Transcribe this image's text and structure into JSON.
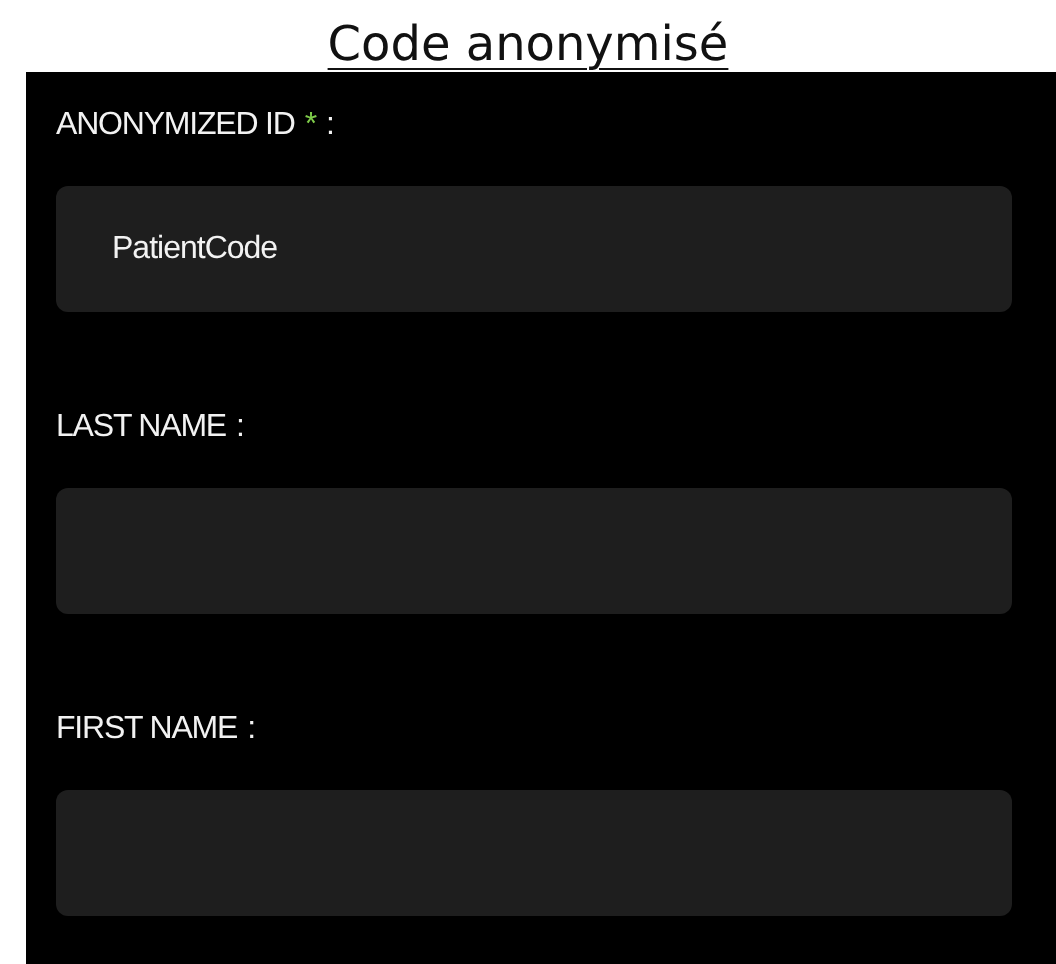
{
  "title": "Code anonymisé",
  "fields": [
    {
      "label": "ANONYMIZED ID",
      "required_mark": "*",
      "separator": ":",
      "value": "PatientCode"
    },
    {
      "label": "LAST NAME",
      "separator": ":"
    },
    {
      "label": "FIRST NAME",
      "separator": ":"
    }
  ]
}
